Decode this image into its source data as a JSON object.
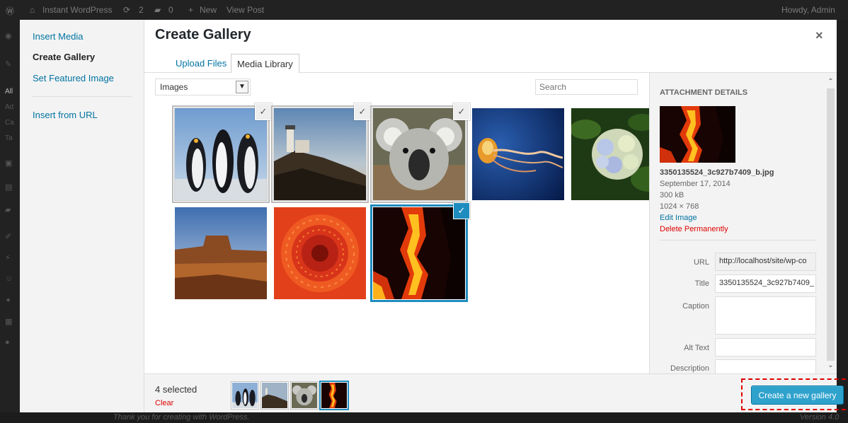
{
  "adminbar": {
    "site_name": "Instant WordPress",
    "updates": "2",
    "comments": "0",
    "new_label": "New",
    "view_post": "View Post",
    "howdy": "Howdy, Admin"
  },
  "background": {
    "footer_text": "Thank you for creating with WordPress.",
    "version": "Version 4.0",
    "menu_letters": [
      "All",
      "Ad",
      "Ca",
      "Ta"
    ]
  },
  "menu": {
    "items": [
      {
        "label": "Insert Media",
        "active": false
      },
      {
        "label": "Create Gallery",
        "active": true
      },
      {
        "label": "Set Featured Image",
        "active": false
      },
      {
        "label": "Insert from URL",
        "active": false
      }
    ]
  },
  "modal": {
    "title": "Create Gallery",
    "close_label": "×"
  },
  "tabs": [
    {
      "label": "Upload Files",
      "active": false
    },
    {
      "label": "Media Library",
      "active": true
    }
  ],
  "toolbar_filters": {
    "filter_value": "Images",
    "search_placeholder": "Search"
  },
  "attachments": [
    {
      "name": "penguins",
      "selected": true
    },
    {
      "name": "lighthouse",
      "selected": true
    },
    {
      "name": "koala",
      "selected": true
    },
    {
      "name": "jellyfish",
      "selected": false
    },
    {
      "name": "hydrangeas",
      "selected": false
    },
    {
      "name": "desert",
      "selected": false
    },
    {
      "name": "chrysanthemum",
      "selected": false
    },
    {
      "name": "fire",
      "selected": true,
      "details": true
    }
  ],
  "details": {
    "heading": "ATTACHMENT DETAILS",
    "filename": "3350135524_3c927b7409_b.jpg",
    "date": "September 17, 2014",
    "size": "300 kB",
    "dimensions": "1024 × 768",
    "edit_link": "Edit Image",
    "delete_link": "Delete Permanently",
    "fields": {
      "url_label": "URL",
      "url_value": "http://localhost/site/wp-co",
      "title_label": "Title",
      "title_value": "3350135524_3c927b7409_",
      "caption_label": "Caption",
      "caption_value": "",
      "alt_label": "Alt Text",
      "alt_value": "",
      "description_label": "Description"
    }
  },
  "footer": {
    "selected_count": "4 selected",
    "clear_label": "Clear",
    "button_label": "Create a new gallery"
  },
  "colors": {
    "accent": "#2ea2cc",
    "link": "#0074a2",
    "delete": "#dd0000",
    "highlight_border": "#e00000"
  }
}
